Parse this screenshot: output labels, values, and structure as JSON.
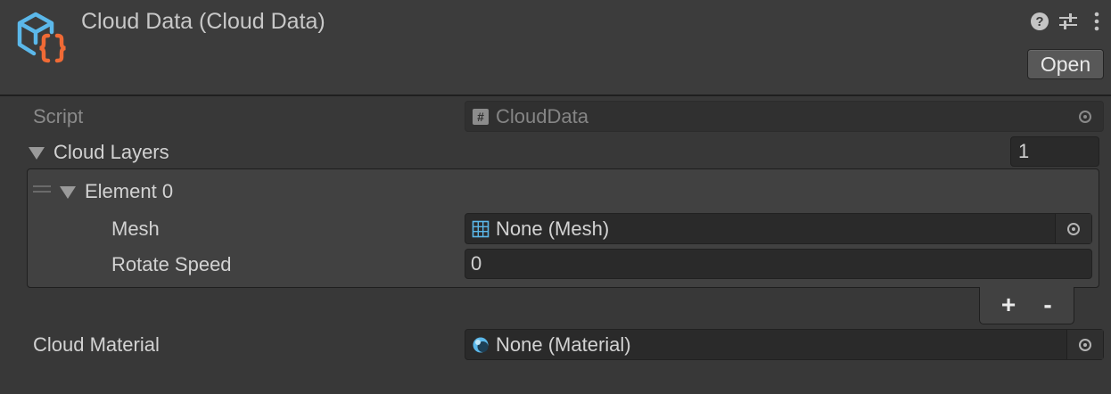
{
  "header": {
    "title": "Cloud Data (Cloud Data)",
    "open_label": "Open",
    "icons": [
      "help-icon",
      "preset-sliders-icon",
      "more-menu-icon"
    ]
  },
  "fields": {
    "script": {
      "label": "Script",
      "value": "CloudData",
      "icon": "csharp-script-icon"
    },
    "cloud_layers": {
      "label": "Cloud Layers",
      "size": "1"
    },
    "element0": {
      "label": "Element 0",
      "mesh": {
        "label": "Mesh",
        "value": "None (Mesh)",
        "icon": "mesh-grid-icon"
      },
      "rotate_speed": {
        "label": "Rotate Speed",
        "value": "0"
      }
    },
    "list_buttons": {
      "add": "+",
      "remove": "-"
    },
    "cloud_material": {
      "label": "Cloud Material",
      "value": "None (Material)",
      "icon": "material-sphere-icon"
    }
  },
  "colors": {
    "background": "#383838",
    "header_bg": "#3c3c3c",
    "field_bg": "#2a2a2a",
    "icon_blue": "#5bb8ea",
    "icon_orange": "#f06a35"
  }
}
